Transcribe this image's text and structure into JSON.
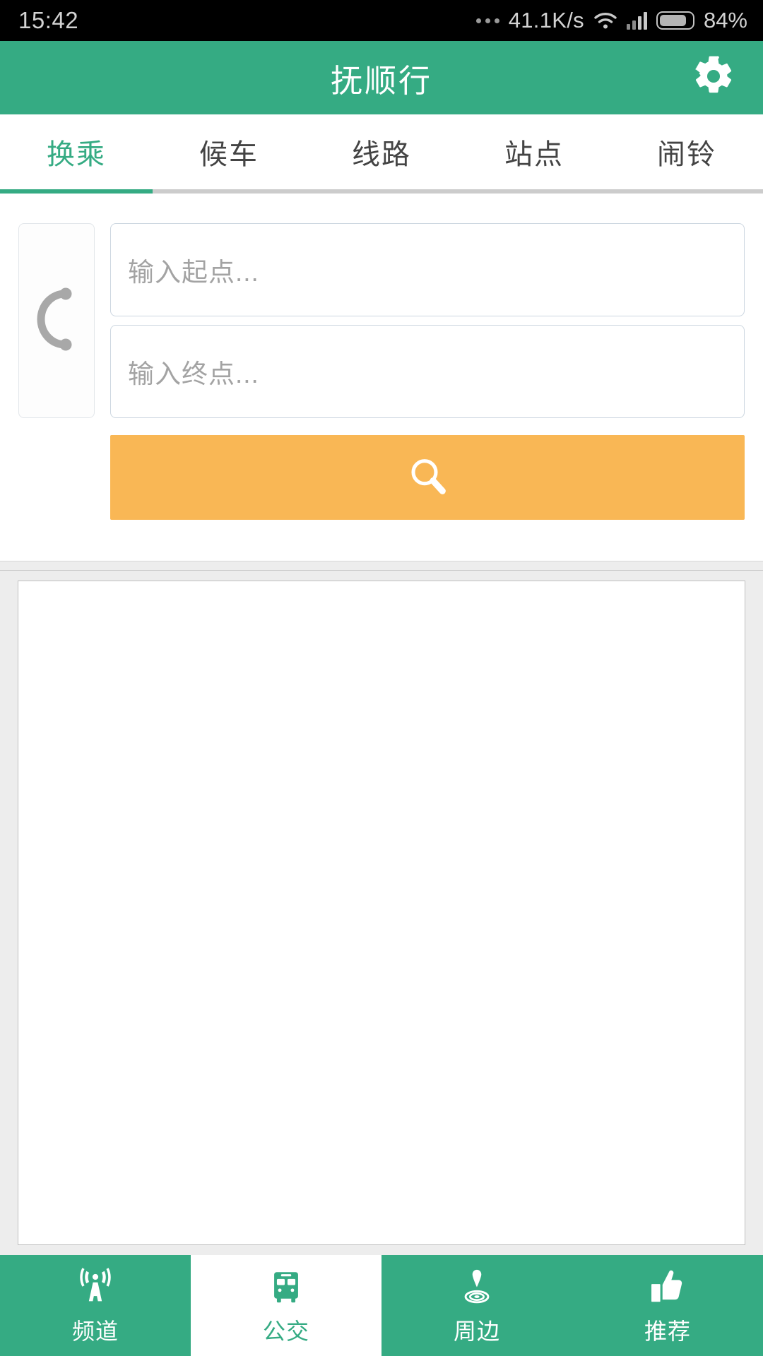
{
  "status_bar": {
    "clock": "15:42",
    "more_icon": "more-dots-icon",
    "net_speed": "41.1K/s",
    "wifi_icon": "wifi-icon",
    "signal_icon": "cellular-signal-icon",
    "battery_icon": "battery-icon",
    "battery_percent": "84%"
  },
  "app_bar": {
    "title": "抚顺行",
    "settings_icon": "gear-icon",
    "background": "#35ab83"
  },
  "tabs": {
    "active_index": 0,
    "items": [
      {
        "label": "换乘"
      },
      {
        "label": "候车"
      },
      {
        "label": "线路"
      },
      {
        "label": "站点"
      },
      {
        "label": "闹铃"
      }
    ],
    "active_color": "#35ab83",
    "inactive_color": "#444444",
    "indicator_track_color": "#cccccc"
  },
  "search": {
    "swap_button": {
      "icon": "swap-arrow-icon"
    },
    "origin": {
      "value": "",
      "placeholder": "输入起点..."
    },
    "destination": {
      "value": "",
      "placeholder": "输入终点..."
    },
    "search_button": {
      "icon": "search-icon",
      "label": "",
      "color": "#f9b755"
    }
  },
  "results": {
    "items": [],
    "empty": true
  },
  "bottom_nav": {
    "active_index": 1,
    "items": [
      {
        "label": "频道",
        "icon": "broadcast-tower-icon"
      },
      {
        "label": "公交",
        "icon": "bus-icon"
      },
      {
        "label": "周边",
        "icon": "location-pin-ripple-icon"
      },
      {
        "label": "推荐",
        "icon": "thumbs-up-icon"
      }
    ],
    "active_color": "#35ab83",
    "background": "#35ab83"
  }
}
